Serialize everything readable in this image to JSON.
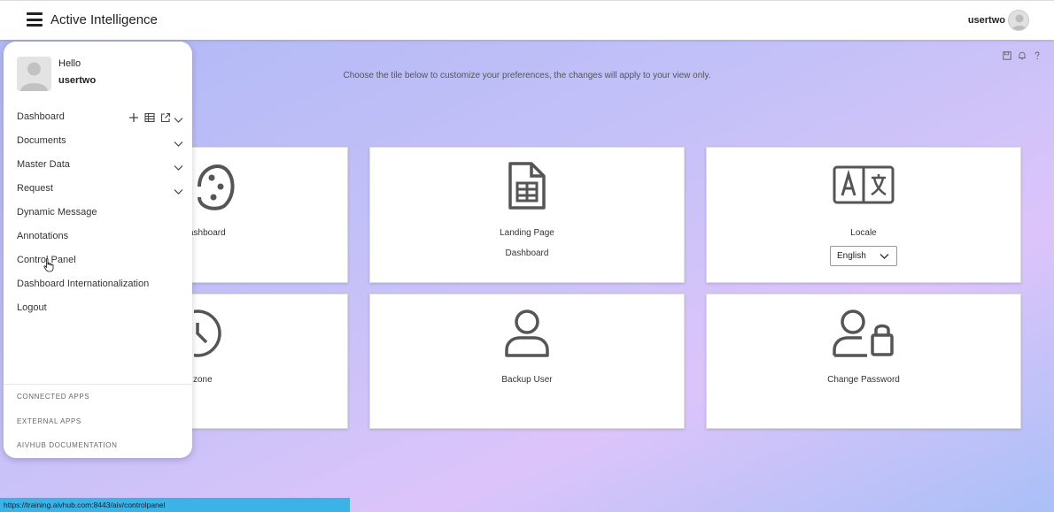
{
  "app": {
    "title": "Active Intelligence",
    "user": "usertwo"
  },
  "main": {
    "instructions": "Choose the tile below to customize your preferences, the changes will apply to your view only.",
    "tiles": [
      {
        "label": "ashboard",
        "sub": "",
        "icon": "palette-icon"
      },
      {
        "label": "Landing Page",
        "sub": "Dashboard",
        "icon": "sheet-document-icon"
      },
      {
        "label": "Locale",
        "sub": "",
        "icon": "translate-icon"
      },
      {
        "label": "zone",
        "sub": "",
        "icon": "clock-icon"
      },
      {
        "label": "Backup User",
        "sub": "",
        "icon": "user-icon"
      },
      {
        "label": "Change Password",
        "sub": "",
        "icon": "user-lock-icon"
      }
    ],
    "locale": {
      "selected": "English"
    }
  },
  "drawer": {
    "hello": "Hello",
    "user": "usertwo",
    "menu": [
      "Dashboard",
      "Documents",
      "Master Data",
      "Request",
      "Dynamic Message",
      "Annotations",
      "Control Panel",
      "Dashboard Internationalization",
      "Logout"
    ],
    "footer": [
      "CONNECTED APPS",
      "EXTERNAL APPS",
      "AIVHUB DOCUMENTATION"
    ]
  },
  "status": {
    "url": "https://training.aivhub.com:8443/aiv/controlpanel"
  },
  "colors": {
    "accent": "#3cb3e6",
    "icon": "#555555"
  }
}
